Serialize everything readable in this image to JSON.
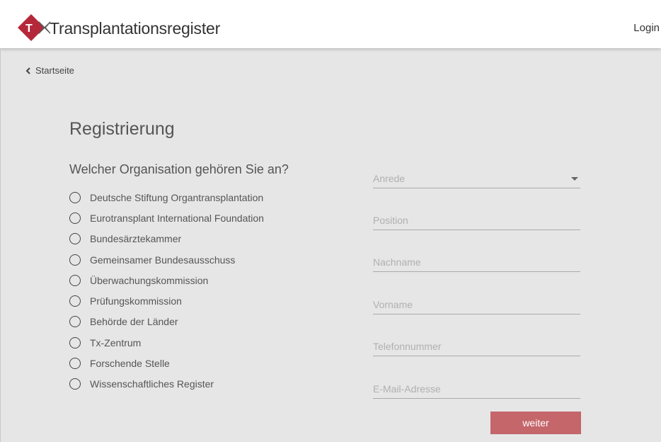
{
  "header": {
    "app_title": "Transplantationsregister",
    "login_label": "Login",
    "logo_icon": "tx-register-logo-icon",
    "brand_color": "#b5283a"
  },
  "nav": {
    "back_label": "Startseite",
    "back_icon": "chevron-left-icon"
  },
  "form": {
    "title": "Registrierung",
    "question": "Welcher Organisation gehören Sie an?",
    "organizations": [
      {
        "label": "Deutsche Stiftung Organtransplantation",
        "selected": false
      },
      {
        "label": "Eurotransplant International Foundation",
        "selected": false
      },
      {
        "label": "Bundesärztekammer",
        "selected": false
      },
      {
        "label": "Gemeinsamer Bundesausschuss",
        "selected": false
      },
      {
        "label": "Überwachungskommission",
        "selected": false
      },
      {
        "label": "Prüfungskommission",
        "selected": false
      },
      {
        "label": "Behörde der Länder",
        "selected": false
      },
      {
        "label": "Tx-Zentrum",
        "selected": false
      },
      {
        "label": "Forschende Stelle",
        "selected": false
      },
      {
        "label": "Wissenschaftliches Register",
        "selected": false
      }
    ],
    "fields": {
      "anrede": {
        "placeholder": "Anrede",
        "value": ""
      },
      "position": {
        "placeholder": "Position",
        "value": ""
      },
      "nachname": {
        "placeholder": "Nachname",
        "value": ""
      },
      "vorname": {
        "placeholder": "Vorname",
        "value": ""
      },
      "telefonnummer": {
        "placeholder": "Telefonnummer",
        "value": ""
      },
      "email": {
        "placeholder": "E-Mail-Adresse",
        "value": ""
      }
    },
    "submit_label": "weiter",
    "submit_color": "#c4666a"
  }
}
